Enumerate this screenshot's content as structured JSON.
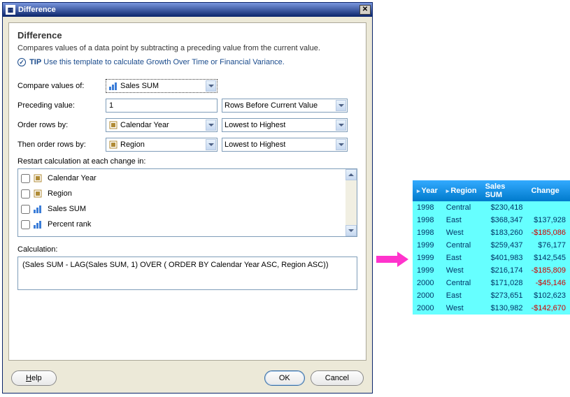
{
  "window": {
    "title": "Difference"
  },
  "panel": {
    "heading": "Difference",
    "description": "Compares values of a data point by subtracting a preceding value from the current value.",
    "tip_label": "TIP",
    "tip_text": "Use this template to calculate Growth Over Time or Financial Variance."
  },
  "form": {
    "compare_label": "Compare values of:",
    "compare_value": "Sales SUM",
    "preceding_label": "Preceding value:",
    "preceding_value": "1",
    "preceding_mode": "Rows Before Current Value",
    "order_label": "Order rows by:",
    "order_value": "Calendar Year",
    "order_dir": "Lowest to Highest",
    "then_label": "Then order rows by:",
    "then_value": "Region",
    "then_dir": "Lowest to Highest",
    "restart_label": "Restart calculation at each change in:",
    "restart_items": [
      "Calendar Year",
      "Region",
      "Sales SUM",
      "Percent rank"
    ],
    "calc_label": "Calculation:",
    "calc_value": "(Sales SUM - LAG(Sales SUM, 1) OVER ( ORDER BY Calendar Year ASC, Region ASC))"
  },
  "buttons": {
    "help": "Help",
    "ok": "OK",
    "cancel": "Cancel"
  },
  "result": {
    "columns": [
      "Year",
      "Region",
      "Sales SUM",
      "Change"
    ],
    "rows": [
      {
        "year": "1998",
        "region": "Central",
        "sales": "$230,418",
        "change": ""
      },
      {
        "year": "1998",
        "region": "East",
        "sales": "$368,347",
        "change": "$137,928"
      },
      {
        "year": "1998",
        "region": "West",
        "sales": "$183,260",
        "change": "-$185,086",
        "neg": true
      },
      {
        "year": "1999",
        "region": "Central",
        "sales": "$259,437",
        "change": "$76,177"
      },
      {
        "year": "1999",
        "region": "East",
        "sales": "$401,983",
        "change": "$142,545"
      },
      {
        "year": "1999",
        "region": "West",
        "sales": "$216,174",
        "change": "-$185,809",
        "neg": true
      },
      {
        "year": "2000",
        "region": "Central",
        "sales": "$171,028",
        "change": "-$45,146",
        "neg": true
      },
      {
        "year": "2000",
        "region": "East",
        "sales": "$273,651",
        "change": "$102,623"
      },
      {
        "year": "2000",
        "region": "West",
        "sales": "$130,982",
        "change": "-$142,670",
        "neg": true
      }
    ]
  }
}
